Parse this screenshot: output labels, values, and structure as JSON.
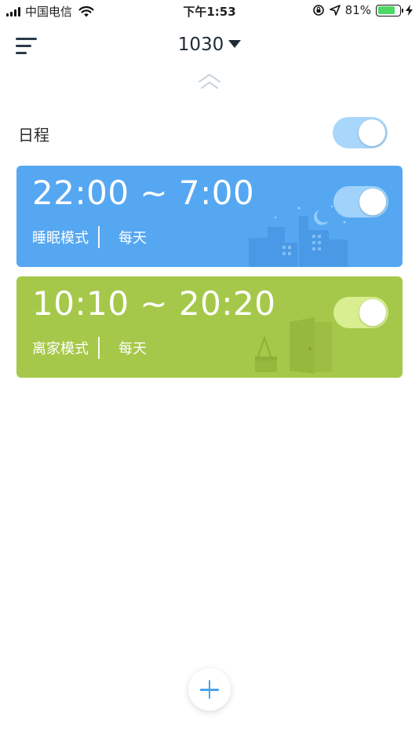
{
  "status_bar": {
    "carrier": "中国电信",
    "time": "下午1:53",
    "battery_percent": "81%",
    "battery_level": 0.81
  },
  "header": {
    "device_name": "1030"
  },
  "schedule": {
    "label": "日程",
    "enabled": true
  },
  "cards": [
    {
      "time_range": "22:00 ~ 7:00",
      "mode": "睡眠模式",
      "repeat": "每天",
      "enabled": true,
      "color": "#56a7f1",
      "illustration": "night-city-icon"
    },
    {
      "time_range": "10:10 ~ 20:20",
      "mode": "离家模式",
      "repeat": "每天",
      "enabled": true,
      "color": "#a6c84a",
      "illustration": "bag-and-door-icon"
    }
  ],
  "colors": {
    "accent": "#4aa3ec",
    "toggle_on": "#a9d7fb"
  }
}
